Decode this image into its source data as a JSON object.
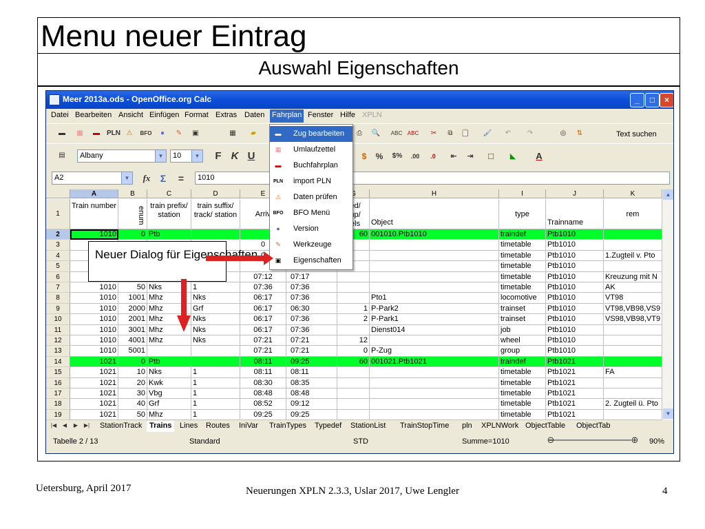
{
  "slide": {
    "title": "Menu neuer Eintrag",
    "subtitle": "Auswahl Eigenschaften",
    "footer_left": "Uetersburg, April 2017",
    "footer_center": "Neuerungen XPLN 2.3.3, Uslar 2017, Uwe Lengler",
    "page_number": "4",
    "callout": "Neuer Dialog für Eigenschaften"
  },
  "window": {
    "title": "Meer 2013a.ods - OpenOffice.org Calc"
  },
  "menubar": [
    "Datei",
    "Bearbeiten",
    "Ansicht",
    "Einfügen",
    "Format",
    "Extras",
    "Daten",
    "Fahrplan",
    "Fenster",
    "Hilfe",
    "XPLN"
  ],
  "toolbar": {
    "search_label": "Text suchen",
    "font_name": "Albany",
    "font_size": "10",
    "bold": "F",
    "italic": "K",
    "underline": "U",
    "cell_ref": "A2",
    "formula_value": "1010",
    "plugin_labels": [
      "PLN",
      "BFO"
    ],
    "percent": "%"
  },
  "fahrplan_menu": [
    {
      "label": "Zug bearbeiten",
      "icon": "train-icon"
    },
    {
      "label": "Umlaufzettel",
      "icon": "sheet-icon"
    },
    {
      "label": "Buchfahrplan",
      "icon": "train-red-icon"
    },
    {
      "label": "import PLN",
      "icon": "pln-icon"
    },
    {
      "label": "Daten prüfen",
      "icon": "warning-icon"
    },
    {
      "label": "BFO Menü",
      "icon": "bfo-icon"
    },
    {
      "label": "Version",
      "icon": "globe-icon"
    },
    {
      "label": "Werkzeuge",
      "icon": "tools-icon"
    },
    {
      "label": "Eigenschaften",
      "icon": "properties-icon"
    }
  ],
  "columns": [
    "A",
    "B",
    "C",
    "D",
    "E",
    "F",
    "G",
    "H",
    "I",
    "J",
    "K"
  ],
  "header_row": {
    "row": "1",
    "a": "Train number",
    "b": "enum",
    "c": "train prefix/ station",
    "d": "train suffix/ track/ station",
    "e": "Arriv",
    "g": "eed/ oup/ eels",
    "h": "Object",
    "i": "type",
    "j": "Trainname",
    "k": "rem"
  },
  "rows": [
    {
      "n": "2",
      "a": "1010",
      "b": "0",
      "c": "Ptb",
      "d": "",
      "e": "",
      "f": "",
      "g": "60",
      "h": "001010.Ptb1010",
      "i": "traindef",
      "j": "Ptb1010",
      "k": ""
    },
    {
      "n": "3",
      "a": "",
      "b": "",
      "c": "",
      "d": "",
      "e": "0",
      "f": "",
      "g": "",
      "h": "",
      "i": "timetable",
      "j": "Ptb1010",
      "k": ""
    },
    {
      "n": "4",
      "a": "",
      "b": "",
      "c": "",
      "d": "",
      "e": "0",
      "f": "",
      "g": "",
      "h": "",
      "i": "timetable",
      "j": "Ptb1010",
      "k": "1.Zugteil  v. Pto"
    },
    {
      "n": "5",
      "a": "",
      "b": "",
      "c": "",
      "d": "",
      "e": "",
      "f": "",
      "g": "",
      "h": "",
      "i": "timetable",
      "j": "Ptb1010",
      "k": ""
    },
    {
      "n": "6",
      "a": "",
      "b": "",
      "c": "",
      "d": "",
      "e": "07:12",
      "f": "07:17",
      "g": "",
      "h": "",
      "i": "timetable",
      "j": "Ptb1010",
      "k": "Kreuzung mit N"
    },
    {
      "n": "7",
      "a": "1010",
      "b": "50",
      "c": "Nks",
      "d": "1",
      "e": "07:36",
      "f": "07:36",
      "g": "",
      "h": "",
      "i": "timetable",
      "j": "Ptb1010",
      "k": "AK"
    },
    {
      "n": "8",
      "a": "1010",
      "b": "1001",
      "c": "Mhz",
      "d": "Nks",
      "e": "06:17",
      "f": "07:36",
      "g": "",
      "h": "Pto1",
      "i": "locomotive",
      "j": "Ptb1010",
      "k": "VT98"
    },
    {
      "n": "9",
      "a": "1010",
      "b": "2000",
      "c": "Mhz",
      "d": "Grf",
      "e": "06:17",
      "f": "06:30",
      "g": "1",
      "h": "P-Park2",
      "i": "trainset",
      "j": "Ptb1010",
      "k": "VT98,VB98,VS9"
    },
    {
      "n": "10",
      "a": "1010",
      "b": "2001",
      "c": "Mhz",
      "d": "Nks",
      "e": "06:17",
      "f": "07:36",
      "g": "2",
      "h": "P-Park1",
      "i": "trainset",
      "j": "Ptb1010",
      "k": "VS98,VB98,VT9"
    },
    {
      "n": "11",
      "a": "1010",
      "b": "3001",
      "c": "Mhz",
      "d": "Nks",
      "e": "06:17",
      "f": "07:36",
      "g": "",
      "h": "Dienst014",
      "i": "job",
      "j": "Ptb1010",
      "k": ""
    },
    {
      "n": "12",
      "a": "1010",
      "b": "4001",
      "c": "Mhz",
      "d": "Nks",
      "e": "07:21",
      "f": "07:21",
      "g": "12",
      "h": "",
      "i": "wheel",
      "j": "Ptb1010",
      "k": ""
    },
    {
      "n": "13",
      "a": "1010",
      "b": "5001",
      "c": "",
      "d": "",
      "e": "07:21",
      "f": "07:21",
      "g": "0",
      "h": "P-Zug",
      "i": "group",
      "j": "Ptb1010",
      "k": ""
    },
    {
      "n": "14",
      "a": "1021",
      "b": "0",
      "c": "Ptb",
      "d": "",
      "e": "08:11",
      "f": "09:25",
      "g": "60",
      "h": "001021.Ptb1021",
      "i": "traindef",
      "j": "Ptb1021",
      "k": ""
    },
    {
      "n": "15",
      "a": "1021",
      "b": "10",
      "c": "Nks",
      "d": "1",
      "e": "08:11",
      "f": "08:11",
      "g": "",
      "h": "",
      "i": "timetable",
      "j": "Ptb1021",
      "k": "FA"
    },
    {
      "n": "16",
      "a": "1021",
      "b": "20",
      "c": "Kwk",
      "d": "1",
      "e": "08:30",
      "f": "08:35",
      "g": "",
      "h": "",
      "i": "timetable",
      "j": "Ptb1021",
      "k": ""
    },
    {
      "n": "17",
      "a": "1021",
      "b": "30",
      "c": "Vbg",
      "d": "1",
      "e": "08:48",
      "f": "08:48",
      "g": "",
      "h": "",
      "i": "timetable",
      "j": "Ptb1021",
      "k": ""
    },
    {
      "n": "18",
      "a": "1021",
      "b": "40",
      "c": "Grf",
      "d": "1",
      "e": "08:52",
      "f": "09:12",
      "g": "",
      "h": "",
      "i": "timetable",
      "j": "Ptb1021",
      "k": "2. Zugteil ü. Pto"
    },
    {
      "n": "19",
      "a": "1021",
      "b": "50",
      "c": "Mhz",
      "d": "1",
      "e": "09:25",
      "f": "09:25",
      "g": "",
      "h": "",
      "i": "timetable",
      "j": "Ptb1021",
      "k": ""
    }
  ],
  "sheet_tabs": [
    "StationTrack",
    "Trains",
    "Lines",
    "Routes",
    "IniVar",
    "TrainTypes",
    "Typedef",
    "StationList",
    "TrainStopTime",
    "pln",
    "XPLNWork",
    "ObjectTable",
    "ObjectTab"
  ],
  "active_tab": "Trains",
  "status": {
    "sheet": "Tabelle 2 / 13",
    "style": "Standard",
    "mode": "STD",
    "sum": "Summe=1010",
    "zoom": "90%"
  },
  "colors": {
    "green_row": "#00ff2a",
    "menu_highlight": "#316ac5",
    "arrow": "#dd2222"
  }
}
